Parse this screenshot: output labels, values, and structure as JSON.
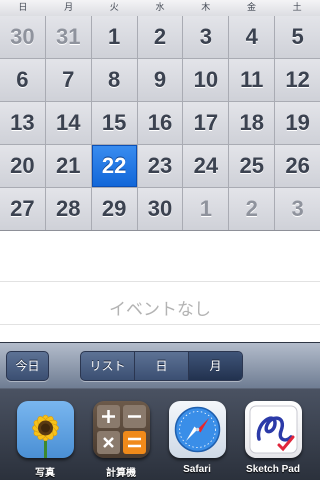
{
  "calendar": {
    "weekdays": [
      "日",
      "月",
      "火",
      "水",
      "木",
      "金",
      "土"
    ],
    "days": [
      {
        "label": "30",
        "state": "other"
      },
      {
        "label": "31",
        "state": "other"
      },
      {
        "label": "1",
        "state": "current"
      },
      {
        "label": "2",
        "state": "current"
      },
      {
        "label": "3",
        "state": "current"
      },
      {
        "label": "4",
        "state": "current"
      },
      {
        "label": "5",
        "state": "current"
      },
      {
        "label": "6",
        "state": "current"
      },
      {
        "label": "7",
        "state": "current"
      },
      {
        "label": "8",
        "state": "current"
      },
      {
        "label": "9",
        "state": "current"
      },
      {
        "label": "10",
        "state": "current"
      },
      {
        "label": "11",
        "state": "current"
      },
      {
        "label": "12",
        "state": "current"
      },
      {
        "label": "13",
        "state": "current"
      },
      {
        "label": "14",
        "state": "current"
      },
      {
        "label": "15",
        "state": "current"
      },
      {
        "label": "16",
        "state": "current"
      },
      {
        "label": "17",
        "state": "current"
      },
      {
        "label": "18",
        "state": "current"
      },
      {
        "label": "19",
        "state": "current"
      },
      {
        "label": "20",
        "state": "current"
      },
      {
        "label": "21",
        "state": "current"
      },
      {
        "label": "22",
        "state": "today"
      },
      {
        "label": "23",
        "state": "current"
      },
      {
        "label": "24",
        "state": "current"
      },
      {
        "label": "25",
        "state": "current"
      },
      {
        "label": "26",
        "state": "current"
      },
      {
        "label": "27",
        "state": "current"
      },
      {
        "label": "28",
        "state": "current"
      },
      {
        "label": "29",
        "state": "current"
      },
      {
        "label": "30",
        "state": "current"
      },
      {
        "label": "1",
        "state": "other"
      },
      {
        "label": "2",
        "state": "other"
      },
      {
        "label": "3",
        "state": "other"
      }
    ]
  },
  "events": {
    "empty_text": "イベントなし"
  },
  "toolbar": {
    "today_label": "今日",
    "views": [
      {
        "label": "リスト",
        "active": false
      },
      {
        "label": "日",
        "active": false
      },
      {
        "label": "月",
        "active": true
      }
    ]
  },
  "dock": {
    "apps": [
      {
        "label": "写真",
        "icon": "sunflower-icon"
      },
      {
        "label": "計算機",
        "icon": "calculator-icon"
      },
      {
        "label": "Safari",
        "icon": "compass-icon"
      },
      {
        "label": "Sketch Pad",
        "icon": "sketch-pen-icon"
      }
    ]
  },
  "colors": {
    "accent": "#1a73e0",
    "today_fill": "#1166d8"
  }
}
